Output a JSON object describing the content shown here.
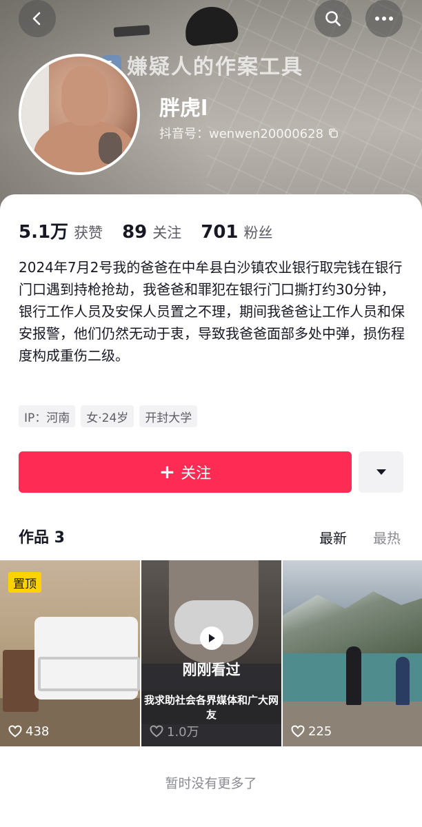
{
  "nav": {
    "back_icon": "chevron-left-icon",
    "search_icon": "search-icon",
    "more_icon": "more-dots-icon"
  },
  "header": {
    "watermark_text": "嫌疑人的作案工具"
  },
  "profile": {
    "username": "胖虎l",
    "douyin_id": "抖音号：wenwen20000628",
    "copy_icon": "copy-icon"
  },
  "stats": [
    {
      "value": "5.1万",
      "label": "获赞"
    },
    {
      "value": "89",
      "label": "关注"
    },
    {
      "value": "701",
      "label": "粉丝"
    }
  ],
  "bio": "2024年7月2号我的爸爸在中牟县白沙镇农业银行取完钱在银行门口遇到持枪抢劫，我爸爸和罪犯在银行门口撕打约30分钟，银行工作人员及安保人员置之不理，期间我爸爸让工作人员和保安报警，他们仍然无动于衷，导致我爸爸面部多处中弹，损伤程度构成重伤二级。",
  "tags": [
    "IP：河南",
    "女·24岁",
    "开封大学"
  ],
  "actions": {
    "follow_label": "关注",
    "follow_icon": "plus-icon",
    "dropdown_icon": "triangle-down-icon"
  },
  "works": {
    "title": "作品 3",
    "sort_latest": "最新",
    "sort_hot": "最热",
    "items": [
      {
        "badge": "置顶",
        "likes": "438"
      },
      {
        "overlay": "刚刚看过",
        "caption": "我求助社会各界媒体和广大网友",
        "likes": "1.0万"
      },
      {
        "likes": "225"
      }
    ]
  },
  "footer_text": "暂时没有更多了",
  "colors": {
    "accent": "#fe2c55",
    "pin_badge": "#ffd300",
    "text_primary": "#161823",
    "text_secondary": "#8a8b91"
  }
}
